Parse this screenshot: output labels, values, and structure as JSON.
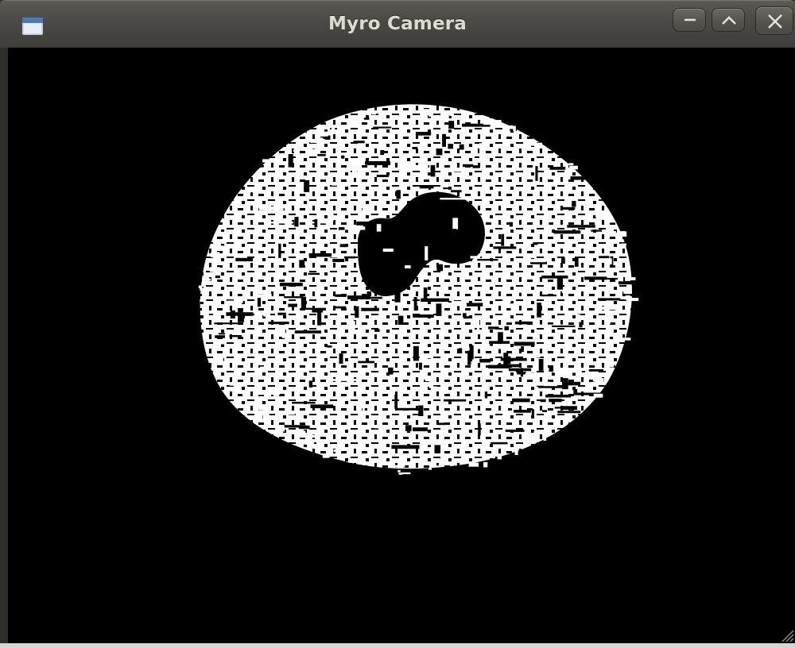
{
  "window": {
    "title": "Myro Camera",
    "icon": "window-icon",
    "controls": [
      {
        "name": "minimize-button",
        "icon": "minimize-icon"
      },
      {
        "name": "maximize-button",
        "icon": "maximize-icon"
      },
      {
        "name": "close-button",
        "icon": "close-icon"
      }
    ]
  },
  "image": {
    "description_icon": "camera-image",
    "background_color": "#000000",
    "foreground_color": "#ffffff"
  },
  "colors": {
    "titlebar": "#4a4945",
    "title_text": "#dfdbd2",
    "frame": "#2f2f2c"
  }
}
